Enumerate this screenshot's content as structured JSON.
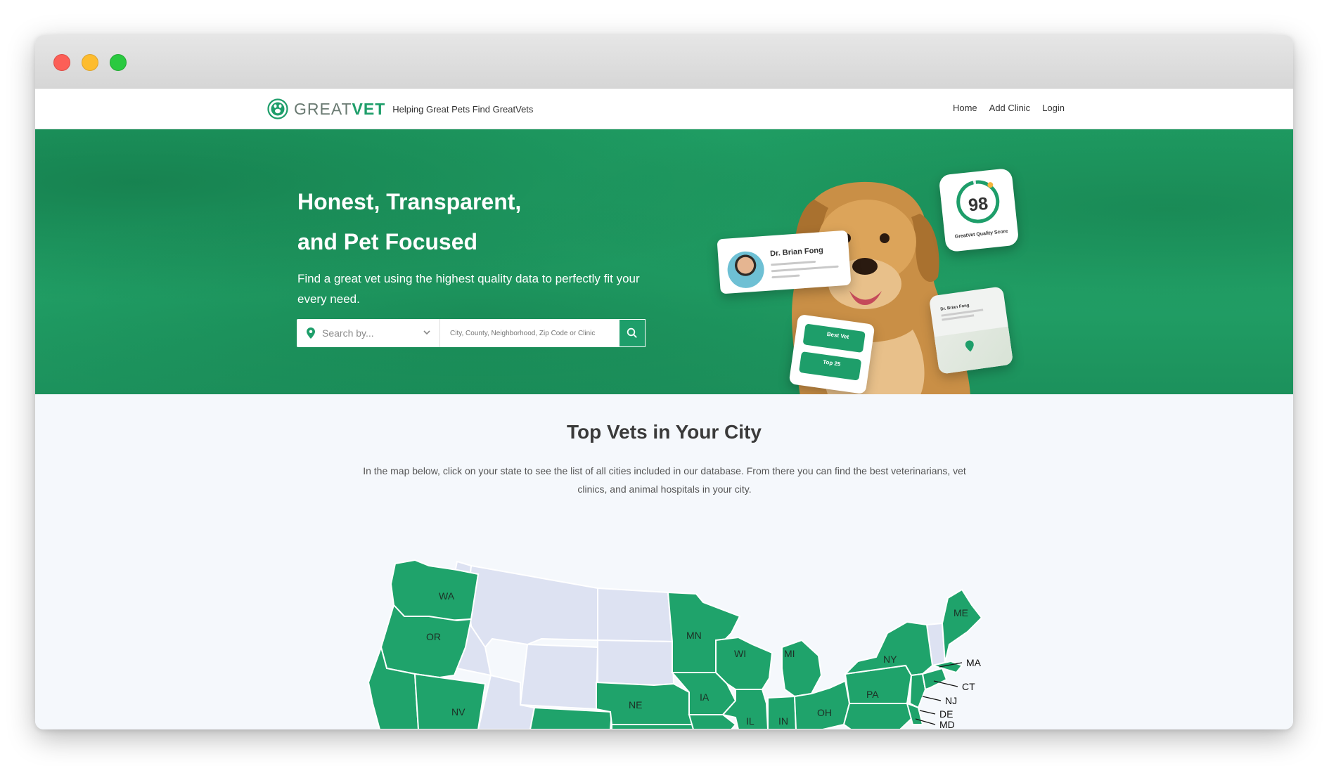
{
  "brand": {
    "name_part1": "GREAT",
    "name_part2": "VET",
    "tagline": "Helping Great Pets Find GreatVets"
  },
  "nav": {
    "home": "Home",
    "add_clinic": "Add Clinic",
    "login": "Login"
  },
  "hero": {
    "title_line1": "Honest, Transparent,",
    "title_line2": "and Pet Focused",
    "subtitle": "Find a great vet using the highest quality data to perfectly fit your every need.",
    "search_select_value": "Search by...",
    "search_placeholder": "City, County, Neighborhood, Zip Code or Clinic"
  },
  "cards": {
    "doctor_name": "Dr. Brian Fong",
    "score": "98",
    "score_label": "GreatVet Quality Score",
    "map_card_title": "Dr. Brian Fong",
    "badge1": "Best Vet",
    "badge2": "Top 25"
  },
  "section": {
    "title": "Top Vets in Your City",
    "description": "In the map below, click on your state to see the list of all cities included in our database. From there you can find the best veterinarians, vet clinics, and animal hospitals in your city."
  },
  "map": {
    "states": {
      "wa": "WA",
      "or": "OR",
      "nv": "NV",
      "ne": "NE",
      "mn": "MN",
      "wi": "WI",
      "mi": "MI",
      "ia": "IA",
      "il": "IL",
      "in": "IN",
      "oh": "OH",
      "pa": "PA",
      "ny": "NY",
      "me": "ME",
      "ma": "MA",
      "ct": "CT",
      "nj": "NJ",
      "de": "DE",
      "md": "MD"
    },
    "active_color": "#1fa36b",
    "inactive_color": "#dde2f2"
  },
  "colors": {
    "brand_green": "#1e9e6a",
    "hero_bg": "#1f9d63"
  }
}
